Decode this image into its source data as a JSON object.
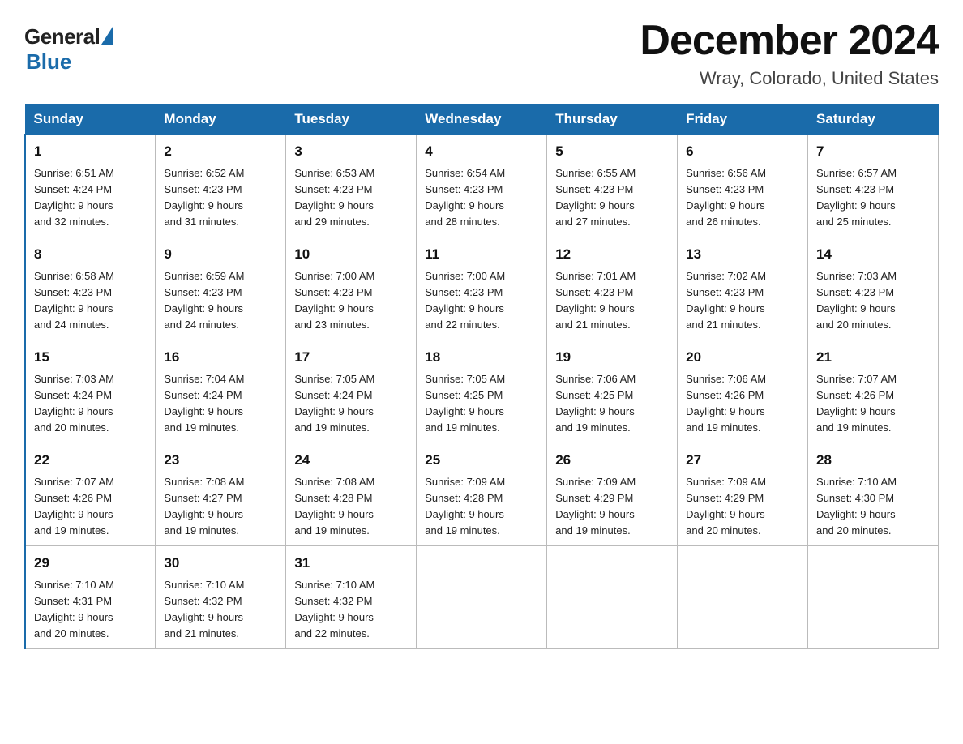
{
  "logo": {
    "general": "General",
    "blue": "Blue"
  },
  "title": "December 2024",
  "subtitle": "Wray, Colorado, United States",
  "days_of_week": [
    "Sunday",
    "Monday",
    "Tuesday",
    "Wednesday",
    "Thursday",
    "Friday",
    "Saturday"
  ],
  "weeks": [
    [
      {
        "day": "1",
        "sunrise": "6:51 AM",
        "sunset": "4:24 PM",
        "daylight": "9 hours and 32 minutes."
      },
      {
        "day": "2",
        "sunrise": "6:52 AM",
        "sunset": "4:23 PM",
        "daylight": "9 hours and 31 minutes."
      },
      {
        "day": "3",
        "sunrise": "6:53 AM",
        "sunset": "4:23 PM",
        "daylight": "9 hours and 29 minutes."
      },
      {
        "day": "4",
        "sunrise": "6:54 AM",
        "sunset": "4:23 PM",
        "daylight": "9 hours and 28 minutes."
      },
      {
        "day": "5",
        "sunrise": "6:55 AM",
        "sunset": "4:23 PM",
        "daylight": "9 hours and 27 minutes."
      },
      {
        "day": "6",
        "sunrise": "6:56 AM",
        "sunset": "4:23 PM",
        "daylight": "9 hours and 26 minutes."
      },
      {
        "day": "7",
        "sunrise": "6:57 AM",
        "sunset": "4:23 PM",
        "daylight": "9 hours and 25 minutes."
      }
    ],
    [
      {
        "day": "8",
        "sunrise": "6:58 AM",
        "sunset": "4:23 PM",
        "daylight": "9 hours and 24 minutes."
      },
      {
        "day": "9",
        "sunrise": "6:59 AM",
        "sunset": "4:23 PM",
        "daylight": "9 hours and 24 minutes."
      },
      {
        "day": "10",
        "sunrise": "7:00 AM",
        "sunset": "4:23 PM",
        "daylight": "9 hours and 23 minutes."
      },
      {
        "day": "11",
        "sunrise": "7:00 AM",
        "sunset": "4:23 PM",
        "daylight": "9 hours and 22 minutes."
      },
      {
        "day": "12",
        "sunrise": "7:01 AM",
        "sunset": "4:23 PM",
        "daylight": "9 hours and 21 minutes."
      },
      {
        "day": "13",
        "sunrise": "7:02 AM",
        "sunset": "4:23 PM",
        "daylight": "9 hours and 21 minutes."
      },
      {
        "day": "14",
        "sunrise": "7:03 AM",
        "sunset": "4:23 PM",
        "daylight": "9 hours and 20 minutes."
      }
    ],
    [
      {
        "day": "15",
        "sunrise": "7:03 AM",
        "sunset": "4:24 PM",
        "daylight": "9 hours and 20 minutes."
      },
      {
        "day": "16",
        "sunrise": "7:04 AM",
        "sunset": "4:24 PM",
        "daylight": "9 hours and 19 minutes."
      },
      {
        "day": "17",
        "sunrise": "7:05 AM",
        "sunset": "4:24 PM",
        "daylight": "9 hours and 19 minutes."
      },
      {
        "day": "18",
        "sunrise": "7:05 AM",
        "sunset": "4:25 PM",
        "daylight": "9 hours and 19 minutes."
      },
      {
        "day": "19",
        "sunrise": "7:06 AM",
        "sunset": "4:25 PM",
        "daylight": "9 hours and 19 minutes."
      },
      {
        "day": "20",
        "sunrise": "7:06 AM",
        "sunset": "4:26 PM",
        "daylight": "9 hours and 19 minutes."
      },
      {
        "day": "21",
        "sunrise": "7:07 AM",
        "sunset": "4:26 PM",
        "daylight": "9 hours and 19 minutes."
      }
    ],
    [
      {
        "day": "22",
        "sunrise": "7:07 AM",
        "sunset": "4:26 PM",
        "daylight": "9 hours and 19 minutes."
      },
      {
        "day": "23",
        "sunrise": "7:08 AM",
        "sunset": "4:27 PM",
        "daylight": "9 hours and 19 minutes."
      },
      {
        "day": "24",
        "sunrise": "7:08 AM",
        "sunset": "4:28 PM",
        "daylight": "9 hours and 19 minutes."
      },
      {
        "day": "25",
        "sunrise": "7:09 AM",
        "sunset": "4:28 PM",
        "daylight": "9 hours and 19 minutes."
      },
      {
        "day": "26",
        "sunrise": "7:09 AM",
        "sunset": "4:29 PM",
        "daylight": "9 hours and 19 minutes."
      },
      {
        "day": "27",
        "sunrise": "7:09 AM",
        "sunset": "4:29 PM",
        "daylight": "9 hours and 20 minutes."
      },
      {
        "day": "28",
        "sunrise": "7:10 AM",
        "sunset": "4:30 PM",
        "daylight": "9 hours and 20 minutes."
      }
    ],
    [
      {
        "day": "29",
        "sunrise": "7:10 AM",
        "sunset": "4:31 PM",
        "daylight": "9 hours and 20 minutes."
      },
      {
        "day": "30",
        "sunrise": "7:10 AM",
        "sunset": "4:32 PM",
        "daylight": "9 hours and 21 minutes."
      },
      {
        "day": "31",
        "sunrise": "7:10 AM",
        "sunset": "4:32 PM",
        "daylight": "9 hours and 22 minutes."
      },
      null,
      null,
      null,
      null
    ]
  ],
  "labels": {
    "sunrise": "Sunrise:",
    "sunset": "Sunset:",
    "daylight": "Daylight:"
  }
}
